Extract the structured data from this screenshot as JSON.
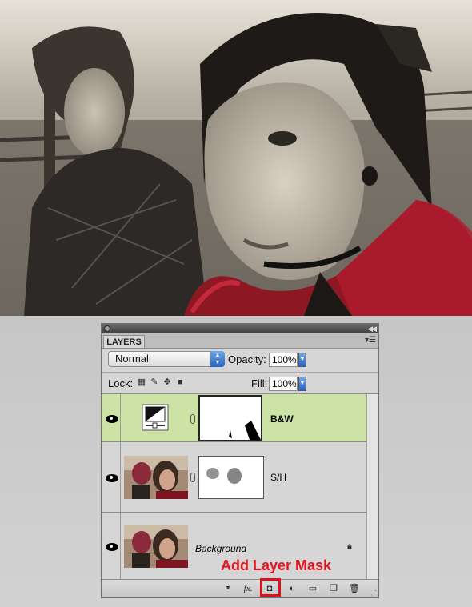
{
  "panel": {
    "tab_label": "LAYERS",
    "blend_mode": "Normal",
    "opacity_label": "Opacity:",
    "opacity_value": "100%",
    "lock_label": "Lock:",
    "fill_label": "Fill:",
    "fill_value": "100%"
  },
  "layers": [
    {
      "name": "B&W",
      "selected": true,
      "kind": "adjustment"
    },
    {
      "name": "S/H",
      "selected": false,
      "kind": "image-with-mask"
    },
    {
      "name": "Background",
      "selected": false,
      "kind": "background",
      "locked": true
    }
  ],
  "annotation": {
    "label": "Add Layer Mask",
    "color": "#e4161f"
  },
  "colors": {
    "selected_row": "#cde3a6",
    "panel_bg": "#d6d6d6",
    "accent_blue": "#2a63c4"
  },
  "icons": {
    "bottom_bar": [
      "link-layers-icon",
      "fx-icon",
      "add-layer-mask-icon",
      "adjustment-layer-icon",
      "new-group-icon",
      "new-layer-icon",
      "trash-icon"
    ]
  }
}
